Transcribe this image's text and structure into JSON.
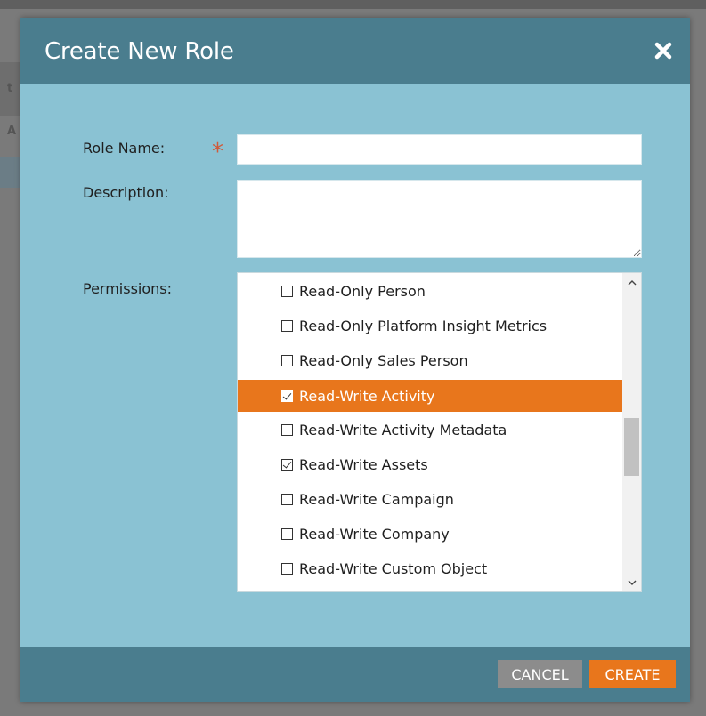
{
  "background": {
    "letters": [
      "t",
      "A"
    ]
  },
  "modal": {
    "title": "Create New Role",
    "close_icon": "close-icon"
  },
  "form": {
    "role_name_label": "Role Name:",
    "required_marker": "*",
    "role_name_value": "",
    "description_label": "Description:",
    "description_value": "",
    "permissions_label": "Permissions:"
  },
  "permissions": [
    {
      "label": "Read-Only Person",
      "checked": false,
      "selected": false
    },
    {
      "label": "Read-Only Platform Insight Metrics",
      "checked": false,
      "selected": false
    },
    {
      "label": "Read-Only Sales Person",
      "checked": false,
      "selected": false
    },
    {
      "label": "Read-Write Activity",
      "checked": true,
      "selected": true
    },
    {
      "label": "Read-Write Activity Metadata",
      "checked": false,
      "selected": false
    },
    {
      "label": "Read-Write Assets",
      "checked": true,
      "selected": false
    },
    {
      "label": "Read-Write Campaign",
      "checked": false,
      "selected": false
    },
    {
      "label": "Read-Write Company",
      "checked": false,
      "selected": false
    },
    {
      "label": "Read-Write Custom Object",
      "checked": false,
      "selected": false
    }
  ],
  "scrollbar": {
    "up_icon": "chevron-up-icon",
    "down_icon": "chevron-down-icon"
  },
  "footer": {
    "cancel_label": "CANCEL",
    "create_label": "CREATE"
  },
  "colors": {
    "header": "#4a7d8e",
    "body": "#8ac2d3",
    "accent": "#e8761c",
    "cancel": "#8c8c8c",
    "required": "#d05a3a"
  }
}
